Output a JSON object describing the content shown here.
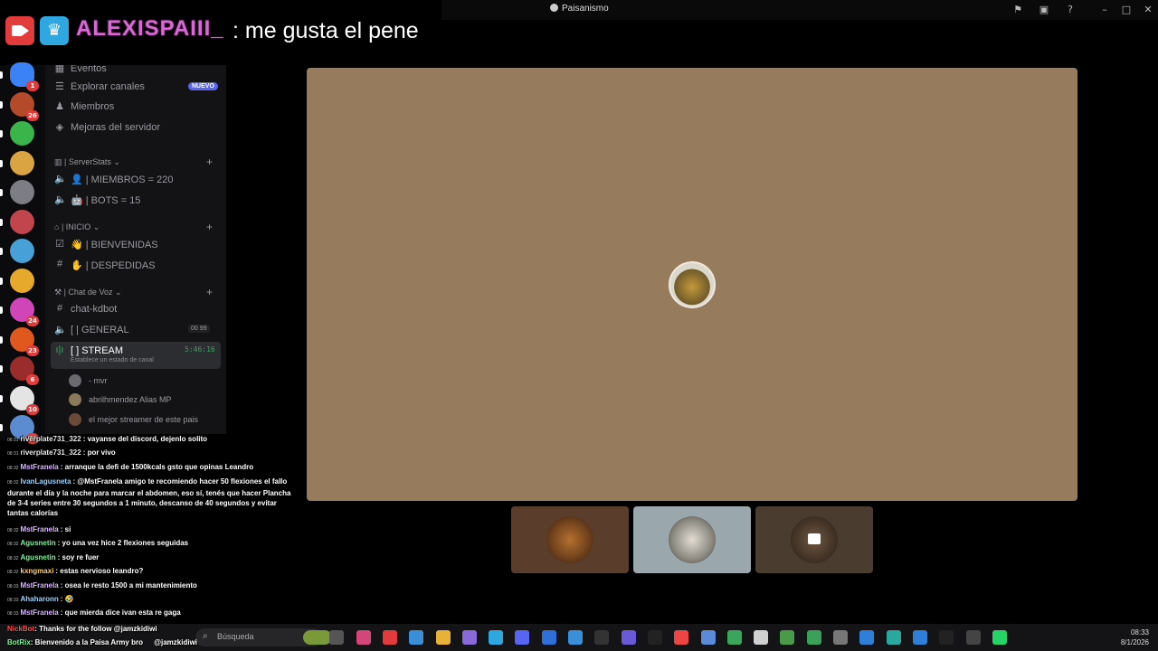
{
  "window": {
    "title": "Paisanismo"
  },
  "overlay_banner": {
    "username": "ALEXISPAIII_",
    "message": ": me gusta el pene"
  },
  "server_rail": [
    {
      "badge": "1",
      "color": "#3b82f6"
    },
    {
      "badge": "26",
      "color": "#b44a2a"
    },
    {
      "badge": "",
      "color": "#39b54a"
    },
    {
      "badge": "",
      "color": "#d9a441"
    },
    {
      "badge": "",
      "color": "#7d7d85"
    },
    {
      "badge": "",
      "color": "#c2454d"
    },
    {
      "badge": "",
      "color": "#48a0d8"
    },
    {
      "badge": "",
      "color": "#e7a92c"
    },
    {
      "badge": "24",
      "color": "#d046b8"
    },
    {
      "badge": "23",
      "color": "#e0581e"
    },
    {
      "badge": "6",
      "color": "#9b2c2c"
    },
    {
      "badge": "10",
      "color": "#e4e4e4"
    },
    {
      "badge": "79",
      "color": "#5b8bd0"
    }
  ],
  "sidebar": {
    "top_items": [
      {
        "label": "Eventos",
        "icon": "calendar-icon"
      },
      {
        "label": "Explorar canales",
        "icon": "compass-icon",
        "badge": "NUEVO"
      },
      {
        "label": "Miembros",
        "icon": "members-icon"
      },
      {
        "label": "Mejoras del servidor",
        "icon": "boost-icon"
      }
    ],
    "categories": [
      {
        "name": "| ServerStats",
        "channels": [
          {
            "label": "| MIEMBROS = 220",
            "icon": "speaker-icon"
          },
          {
            "label": "| BOTS = 15",
            "icon": "speaker-icon"
          }
        ]
      },
      {
        "name": "| INICIO",
        "channels": [
          {
            "label": "| BIENVENIDAS",
            "icon": "rules-icon"
          },
          {
            "label": "| DESPEDIDAS",
            "icon": "hash-icon"
          }
        ]
      },
      {
        "name": "| Chat de Voz",
        "channels": [
          {
            "label": "chat-kdbot",
            "icon": "hash-icon"
          },
          {
            "label": "[ | GENERAL",
            "icon": "speaker-icon",
            "counts": "00 99"
          },
          {
            "label": "[ ] STREAM",
            "icon": "voice-active-icon",
            "timer": "5:46:16",
            "status": "Establece un estado de canal"
          }
        ]
      }
    ],
    "voice_users": [
      {
        "name": "- mvr"
      },
      {
        "name": "abrilhmendez Alias MP"
      },
      {
        "name": "el mejor streamer de este pais"
      }
    ]
  },
  "chat": [
    {
      "time": "08:31",
      "user": "riverplate731_322",
      "cls": "u-river",
      "text": ": vayanse del discord, dejenlo solito"
    },
    {
      "time": "08:31",
      "user": "riverplate731_322",
      "cls": "u-river",
      "text": ": por vivo"
    },
    {
      "time": "08:32",
      "user": "MstFranela",
      "cls": "u-mst",
      "text": ": arranque la defi de 1500kcals gsto que opinas Leandro"
    },
    {
      "time": "08:32",
      "user": "IvanLagusneta",
      "cls": "u-ivan",
      "text": ": @MstFranela amigo te recomiendo hacer 50 flexiones el fallo durante el día y la noche para marcar el abdomen, eso sí, tenés que hacer Plancha de 3-4 series entre 30 segundos a 1 minuto, descanso de 40 segundos y evitar tantas calorías"
    },
    {
      "time": "08:32",
      "user": "MstFranela",
      "cls": "u-mst",
      "text": ": si"
    },
    {
      "time": "08:32",
      "user": "Agusnetin",
      "cls": "u-agus",
      "text": ": yo una vez hice 2 flexiones seguidas"
    },
    {
      "time": "08:32",
      "user": "Agusnetin",
      "cls": "u-agus",
      "text": ": soy re fuer"
    },
    {
      "time": "08:32",
      "user": "kxngmaxi",
      "cls": "u-kxng",
      "text": ": estas nervioso leandro?"
    },
    {
      "time": "08:33",
      "user": "MstFranela",
      "cls": "u-mst",
      "text": ": osea le resto 1500 a mi mantenimiento"
    },
    {
      "time": "08:33",
      "user": "Ahaharonn",
      "cls": "u-aha",
      "text": ": 🤣"
    },
    {
      "time": "08:33",
      "user": "MstFranela",
      "cls": "u-mst",
      "text": ": que mierda dice ivan esta re gaga"
    }
  ],
  "bot_lines": [
    {
      "user": "NickBot",
      "text": ": Thanks for the follow @jamzkidiwi"
    },
    {
      "user": "BotRix",
      "text": ": Bienvenido a la Paisa Army bro",
      "extra": "@jamzkidiwi"
    }
  ],
  "taskbar": {
    "search_placeholder": "Búsqueda",
    "time": "08:33",
    "date": "8/1/2026"
  }
}
